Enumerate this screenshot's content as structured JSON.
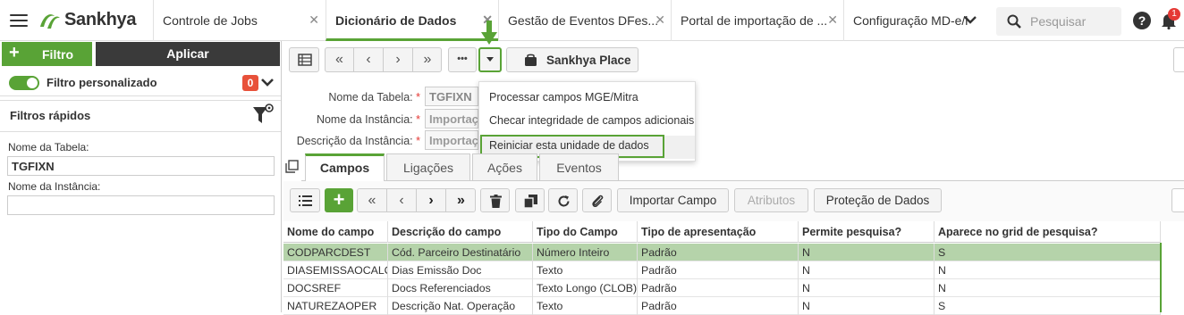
{
  "topbar": {
    "brand": "Sankhya",
    "tabs": [
      {
        "label": "Controle de Jobs"
      },
      {
        "label": "Dicionário de Dados"
      },
      {
        "label": "Gestão de Eventos DFes..."
      },
      {
        "label": "Portal de importação de ..."
      },
      {
        "label": "Configuração MD-e/l"
      }
    ],
    "search_placeholder": "Pesquisar",
    "notifications_count": "1"
  },
  "left": {
    "filter_button": "Filtro",
    "apply_button": "Aplicar",
    "custom_filter_label": "Filtro personalizado",
    "custom_filter_count": "0",
    "quick_filters_title": "Filtros rápidos",
    "fields": [
      {
        "label": "Nome da Tabela:",
        "value": "TGFIXN"
      },
      {
        "label": "Nome da Instância:",
        "value": ""
      }
    ]
  },
  "toolbar": {
    "more_label": "•••",
    "sankhya_place": "Sankhya Place"
  },
  "menu": {
    "items": [
      {
        "label": "Processar campos MGE/Mitra"
      },
      {
        "label": "Checar integridade de campos adicionais"
      },
      {
        "label": "Reiniciar esta unidade de dados"
      }
    ]
  },
  "form": {
    "fields": [
      {
        "label": "Nome da Tabela:",
        "value": "TGFIXN"
      },
      {
        "label": "Nome da Instância:",
        "value": "Importaç"
      },
      {
        "label": "Descrição da Instância:",
        "value": "Importaç"
      }
    ]
  },
  "tabs": [
    {
      "label": "Campos"
    },
    {
      "label": "Ligações"
    },
    {
      "label": "Ações"
    },
    {
      "label": "Eventos"
    }
  ],
  "grid_toolbar": {
    "import_field": "Importar Campo",
    "attributes": "Atributos",
    "data_protection": "Proteção de Dados"
  },
  "grid": {
    "columns": [
      "Nome do campo",
      "Descrição do campo",
      "Tipo do Campo",
      "Tipo de apresentação",
      "Permite pesquisa?",
      "Aparece no grid de pesquisa?"
    ],
    "rows": [
      [
        "CODPARCDEST",
        "Cód. Parceiro Destinatário",
        "Número Inteiro",
        "Padrão",
        "N",
        "S"
      ],
      [
        "DIASEMISSAOCALC",
        "Dias Emissão Doc",
        "Texto",
        "Padrão",
        "N",
        "N"
      ],
      [
        "DOCSREF",
        "Docs Referenciados",
        "Texto Longo (CLOB)",
        "Padrão",
        "N",
        "N"
      ],
      [
        "NATUREZAOPER",
        "Descrição Nat. Operação",
        "Texto",
        "Padrão",
        "N",
        "S"
      ]
    ]
  },
  "colors": {
    "accent": "#59a336",
    "dark": "#3a3a3a",
    "selected_row": "#b5d3aa"
  }
}
